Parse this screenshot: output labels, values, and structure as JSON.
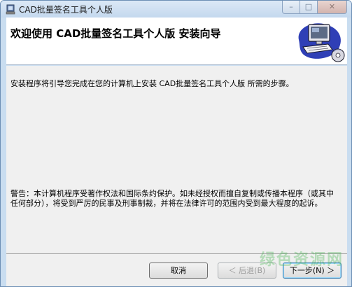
{
  "window": {
    "title": "CAD批量签名工具个人版",
    "caption_minimize": "–",
    "caption_maximize": "□",
    "caption_close": "✕"
  },
  "header": {
    "title": "欢迎使用  CAD批量签名工具个人版  安装向导",
    "art_icon": "computer-disc-icon"
  },
  "content": {
    "intro": "安装程序将引导您完成在您的计算机上安装 CAD批量签名工具个人版 所需的步骤。",
    "warning": "警告：本计算机程序受著作权法和国际条约保护。如未经授权而擅自复制或传播本程序（或其中任何部分），将受到严厉的民事及刑事制裁，并将在法律许可的范围内受到最大程度的起诉。"
  },
  "buttons": {
    "cancel": "取消",
    "back": "＜ 后退(B)",
    "next": "下一步(N) ＞"
  },
  "watermark": "绿色资源网",
  "colors": {
    "header_bg": "#ffffff",
    "body_bg": "#f0f0f0",
    "frame": "#c9ddf0"
  }
}
